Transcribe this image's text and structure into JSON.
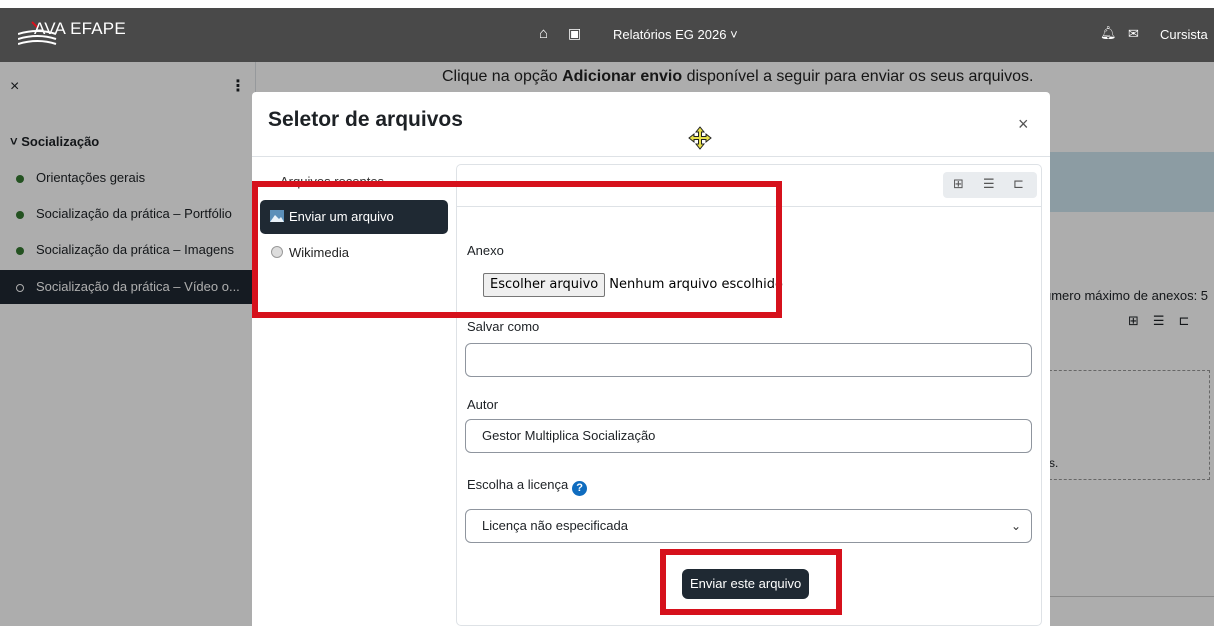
{
  "topbar": {
    "logo_text": "AVA EFAPE",
    "nav_report": "Relatórios EG 2026 ˅",
    "user": "Cursista",
    "home_icon": "⌂",
    "calendar_icon": "▣",
    "bell_icon": "🔔︎",
    "mail_icon": "✉"
  },
  "drawer": {
    "close": "×",
    "menu": "⋮",
    "section": "˅  Socialização",
    "items": [
      "Orientações gerais",
      "Socialização da prática – Portfólio",
      "Socialização da prática – Imagens",
      "Socialização da prática – Vídeo o..."
    ]
  },
  "main": {
    "instruction_pre": "Clique na opção ",
    "instruction_bold": "Adicionar envio",
    "instruction_post": " disponível a seguir para enviar os seus arquivos.",
    "max_attachments": "úmero máximo de anexos: 5",
    "dashed_text": "s."
  },
  "modal": {
    "title": "Seletor de arquivos",
    "close": "×",
    "repos": {
      "recent": "Arquivos recentes",
      "upload": "Enviar um arquivo",
      "wiki": "Wikimedia"
    },
    "view_icons": [
      "⊞",
      "☰",
      "⊏"
    ],
    "form": {
      "attachment_label": "Anexo",
      "choose_file": "Escolher arquivo",
      "no_file": "Nenhum arquivo escolhido",
      "save_as_label": "Salvar como",
      "save_as_value": "",
      "author_label": "Autor",
      "author_value": "Gestor Multiplica Socialização",
      "license_label": "Escolha a licença",
      "license_help": "?",
      "license_value": "Licença não especificada",
      "submit": "Enviar este arquivo"
    }
  },
  "colors": {
    "topbar": "#494949",
    "active_item": "#1f2933",
    "annotation": "#d6111c",
    "help": "#0f6cbf"
  }
}
